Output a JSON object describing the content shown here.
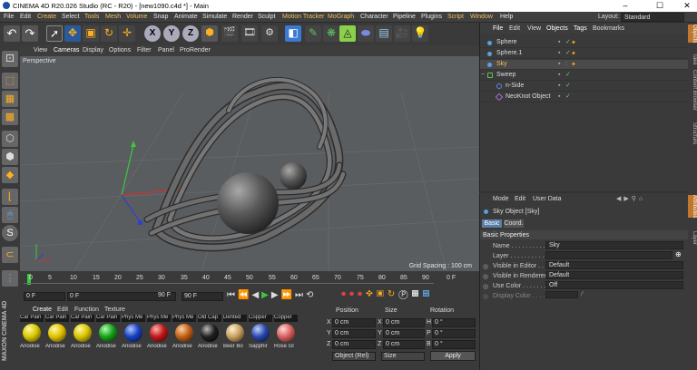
{
  "window": {
    "title": "CINEMA 4D R20.026 Studio (RC - R20) - [new1090.c4d *] - Main",
    "minimize": "–",
    "maximize": "☐",
    "close": "✕"
  },
  "menubar": {
    "items": [
      "File",
      "Edit",
      "Create",
      "Select",
      "Tools",
      "Mesh",
      "Volume",
      "Snap",
      "Animate",
      "Simulate",
      "Render",
      "Sculpt",
      "Motion Tracker",
      "MoGraph",
      "Character",
      "Pipeline",
      "Plugins",
      "Script",
      "Window",
      "Help"
    ],
    "layout_label": "Layout:",
    "layout_value": "Standard"
  },
  "viewport": {
    "menu": [
      "View",
      "Cameras",
      "Display",
      "Options",
      "Filter",
      "Panel",
      "ProRender"
    ],
    "label": "Perspective",
    "grid_spacing": "Grid Spacing : 100 cm"
  },
  "timeline": {
    "ticks": [
      "0",
      "5",
      "10",
      "15",
      "20",
      "25",
      "30",
      "35",
      "40",
      "45",
      "50",
      "55",
      "60",
      "65",
      "70",
      "75",
      "80",
      "85",
      "90"
    ],
    "frame": "0 F"
  },
  "transport": {
    "start": "0 F",
    "current": "0 F",
    "end": "90 F",
    "end2": "90 F"
  },
  "materials": {
    "menu": [
      "Create",
      "Edit",
      "Function",
      "Texture"
    ],
    "items": [
      {
        "label": "Car Pain",
        "name": "Anodise",
        "color": "#d8c800"
      },
      {
        "label": "Car Pain",
        "name": "Anodise",
        "color": "#e0c000"
      },
      {
        "label": "Car Pain",
        "name": "Anodise",
        "color": "#d9c300"
      },
      {
        "label": "Car Pain",
        "name": "Anodise",
        "color": "#18a018"
      },
      {
        "label": "Phys Me",
        "name": "Anodise",
        "color": "#1840c0"
      },
      {
        "label": "Phys Me",
        "name": "Anodise",
        "color": "#c01818"
      },
      {
        "label": "Phys Me",
        "name": "Anodise",
        "color": "#c06018"
      },
      {
        "label": "Old Cap",
        "name": "Anodise",
        "color": "#202020"
      },
      {
        "label": "Dented",
        "name": "Beer Bo",
        "color": "#c8a060"
      },
      {
        "label": "Copper",
        "name": "Sapphir",
        "color": "#2848a8"
      },
      {
        "label": "Copper",
        "name": "Rose Gl",
        "color": "#d86060"
      }
    ]
  },
  "coords": {
    "headers": [
      "Position",
      "Size",
      "Rotation"
    ],
    "rows": [
      {
        "axis": "X",
        "pos": "0 cm",
        "saxis": "X",
        "size": "0 cm",
        "raxis": "H",
        "rot": "0 °"
      },
      {
        "axis": "Y",
        "pos": "0 cm",
        "saxis": "Y",
        "size": "0 cm",
        "raxis": "P",
        "rot": "0 °"
      },
      {
        "axis": "Z",
        "pos": "0 cm",
        "saxis": "Z",
        "size": "0 cm",
        "raxis": "B",
        "rot": "0 °"
      }
    ],
    "mode": "Object (Rel)",
    "size_mode": "Size",
    "apply": "Apply"
  },
  "objects": {
    "menu": [
      "File",
      "Edit",
      "View",
      "Objects",
      "Tags",
      "Bookmarks"
    ],
    "items": [
      {
        "name": "Sphere",
        "icon": "sphere-icon",
        "color": "#5aa0e0"
      },
      {
        "name": "Sphere.1",
        "icon": "sphere-icon",
        "color": "#5aa0e0"
      },
      {
        "name": "Sky",
        "icon": "sky-icon",
        "color": "#5aa0e0"
      },
      {
        "name": "Sweep",
        "icon": "sweep-icon",
        "color": "#60c060"
      },
      {
        "name": "n-Side",
        "icon": "spline-icon",
        "color": "#5a8ae0"
      },
      {
        "name": "NeoKnot Object",
        "icon": "spline-icon",
        "color": "#a070d0"
      }
    ]
  },
  "attributes": {
    "menu": [
      "Mode",
      "Edit",
      "User Data"
    ],
    "title": "Sky Object [Sky]",
    "tabs": [
      "Basic",
      "Coord."
    ],
    "section": "Basic Properties",
    "fields": [
      {
        "label": "Name . . . . . . . . . . . .",
        "value": "Sky"
      },
      {
        "label": "Layer . . . . . . . . . . . .",
        "value": ""
      },
      {
        "label": "Visible in Editor . . .",
        "value": "Default"
      },
      {
        "label": "Visible in Renderer",
        "value": "Default"
      },
      {
        "label": "Use Color . . . . . . . .",
        "value": "Off"
      },
      {
        "label": "Display Color . . . .",
        "value": ""
      }
    ]
  },
  "right_tabs": [
    "Objects",
    "Take",
    "Content Browser",
    "Structure",
    "Attributes",
    "Layer"
  ],
  "left_brand": "MAXON CINEMA 4D"
}
